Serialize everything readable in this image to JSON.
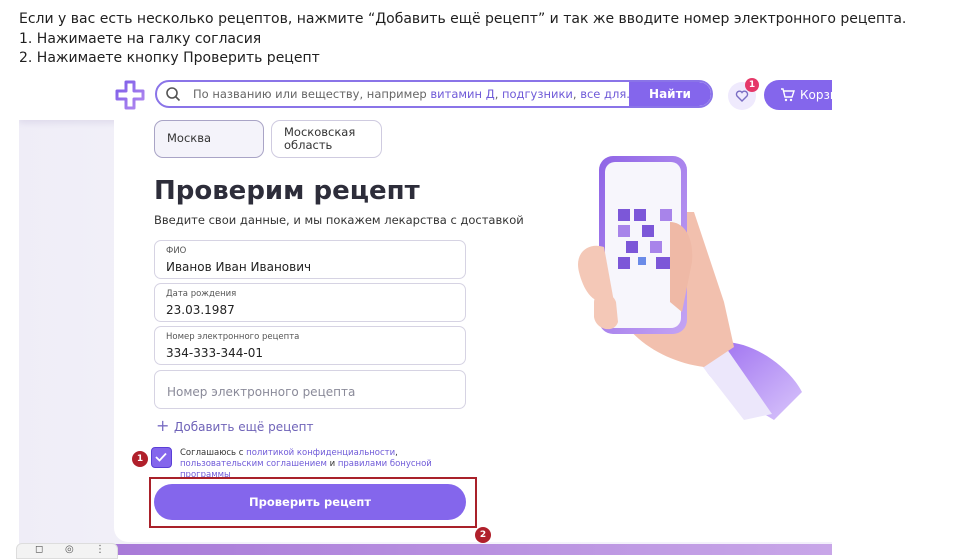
{
  "instructions": [
    "Если у вас есть несколько рецептов, нажмите “Добавить ещё рецепт” и так же вводите номер электронного рецепта.",
    "1. Нажимаете на галку согласия",
    "2. Нажимаете кнопку Проверить рецепт"
  ],
  "header": {
    "search_placeholder_prefix": "По названию или веществу, например",
    "search_example_1": "витамин Д",
    "search_comma_1": ",",
    "search_example_2": "подгузники",
    "search_comma_2": ",",
    "search_example_3": "все для...",
    "find_label": "Найти",
    "favorites_badge": "1",
    "cart_label": "Корзи"
  },
  "cities": [
    {
      "label": "Москва",
      "selected": true
    },
    {
      "label": "Московская\nобласть",
      "selected": false
    }
  ],
  "form": {
    "title": "Проверим рецепт",
    "subtitle": "Введите свои данные, и мы покажем лекарства с доставкой",
    "fields": [
      {
        "label": "ФИО",
        "value": "Иванов Иван Иванович"
      },
      {
        "label": "Дата рождения",
        "value": "23.03.1987"
      },
      {
        "label": "Номер электронного рецепта",
        "value": "334-333-344-01"
      }
    ],
    "empty_field_placeholder": "Номер электронного рецепта",
    "add_more_label": "Добавить ещё рецепт",
    "consent": {
      "text_1": "Соглашаюсь с",
      "link_1": "политикой конфиденциальности",
      "text_2": ",",
      "link_2": "пользовательским соглашением",
      "text_3": "и",
      "link_3": "правилами бонусной программы",
      "checked": true
    },
    "submit_label": "Проверить рецепт"
  },
  "annotations": {
    "marker_1": "1",
    "marker_2": "2",
    "color": "#b0202b"
  },
  "colors": {
    "accent": "#8466ec",
    "brand_link": "#6f5ad8"
  }
}
